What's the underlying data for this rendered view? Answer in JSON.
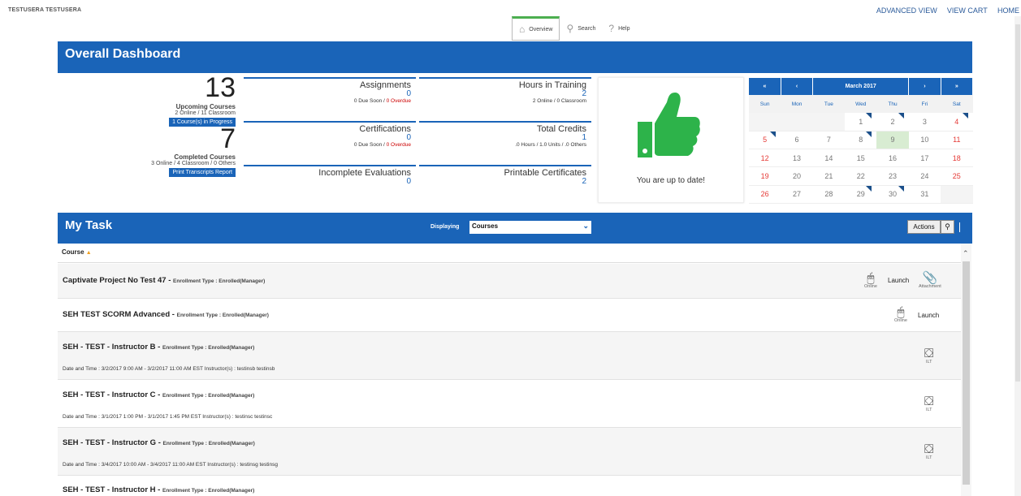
{
  "header": {
    "user": "TESTUSERA TESTUSERA",
    "links": [
      "ADVANCED VIEW",
      "VIEW CART",
      "HOME"
    ]
  },
  "nav": {
    "tabs": [
      {
        "label": "Overview",
        "icon": "home-icon"
      },
      {
        "label": "Search",
        "icon": "search-icon"
      },
      {
        "label": "Help",
        "icon": "help-icon"
      }
    ]
  },
  "dashboard": {
    "title": "Overall Dashboard",
    "upcoming": {
      "count": "13",
      "label": "Upcoming Courses",
      "note": "2 Online / 11 Classroom",
      "progress_btn": "1 Course(s) in Progress"
    },
    "completed": {
      "count": "7",
      "label": "Completed Courses",
      "note": "3 Online / 4 Classroom / 0 Others",
      "print_btn": "Print Transcripts Report"
    },
    "assignments": {
      "title": "Assignments",
      "value": "0",
      "due_soon": "0 Due Soon / ",
      "overdue": "0 Overdue"
    },
    "hours": {
      "title": "Hours in Training",
      "value": "2",
      "note": "2 Online / 0 Classroom"
    },
    "certifications": {
      "title": "Certifications",
      "value": "0",
      "due_soon": "0 Due Soon / ",
      "overdue": "0 Overdue"
    },
    "credits": {
      "title": "Total Credits",
      "value": "1",
      "note": ".0 Hours / 1.0 Units / .0 Others"
    },
    "evaluations": {
      "title": "Incomplete Evaluations",
      "value": "0"
    },
    "certificates": {
      "title": "Printable Certificates",
      "value": "2"
    },
    "status": {
      "text": "You are up to date!",
      "icon": "thumbs-up-icon",
      "color": "#2db34a"
    }
  },
  "calendar": {
    "month": "March 2017",
    "nav": [
      "«",
      "‹",
      "›",
      "»"
    ],
    "days": [
      "Sun",
      "Mon",
      "Tue",
      "Wed",
      "Thu",
      "Fri",
      "Sat"
    ],
    "weeks": [
      [
        "",
        "",
        "",
        "1",
        "2",
        "3",
        "4"
      ],
      [
        "5",
        "6",
        "7",
        "8",
        "9",
        "10",
        "11"
      ],
      [
        "12",
        "13",
        "14",
        "15",
        "16",
        "17",
        "18"
      ],
      [
        "19",
        "20",
        "21",
        "22",
        "23",
        "24",
        "25"
      ],
      [
        "26",
        "27",
        "28",
        "29",
        "30",
        "31",
        ""
      ]
    ],
    "marked_days": [
      "1",
      "2",
      "4",
      "5",
      "8",
      "29",
      "30"
    ],
    "today": "9"
  },
  "task": {
    "title": "My Task",
    "displaying_label": "Displaying",
    "displaying_value": "Courses",
    "actions": "Actions",
    "column": "Course",
    "sort_mark": "▲",
    "rows": [
      {
        "title": "Captivate Project No Test 47",
        "etype": "Enrollment Type : Enrolled(Manager)",
        "launch": "Launch",
        "online": "Online",
        "attachment": "Attachment"
      },
      {
        "title": "SEH TEST SCORM Advanced",
        "etype": "Enrollment Type : Enrolled(Manager)",
        "launch": "Launch",
        "online": "Online"
      },
      {
        "title": "SEH - TEST - Instructor B",
        "etype": "Enrollment Type : Enrolled(Manager)",
        "dt": "Date and Time : 3/2/2017 9:00 AM - 3/2/2017 11:00 AM EST Instructor(s)  : testinsb testinsb",
        "ilt": "ILT"
      },
      {
        "title": "SEH - TEST - Instructor C",
        "etype": "Enrollment Type : Enrolled(Manager)",
        "dt": "Date and Time : 3/1/2017 1:00 PM - 3/1/2017 1:45 PM EST Instructor(s)  : testinsc testinsc",
        "ilt": "ILT"
      },
      {
        "title": "SEH - TEST - Instructor G",
        "etype": "Enrollment Type : Enrolled(Manager)",
        "dt": "Date and Time : 3/4/2017 10:00 AM - 3/4/2017 11:00 AM EST Instructor(s)  : testinsg testinsg",
        "ilt": "ILT"
      },
      {
        "title": "SEH - TEST - Instructor H",
        "etype": "Enrollment Type : Enrolled(Manager)"
      }
    ]
  }
}
